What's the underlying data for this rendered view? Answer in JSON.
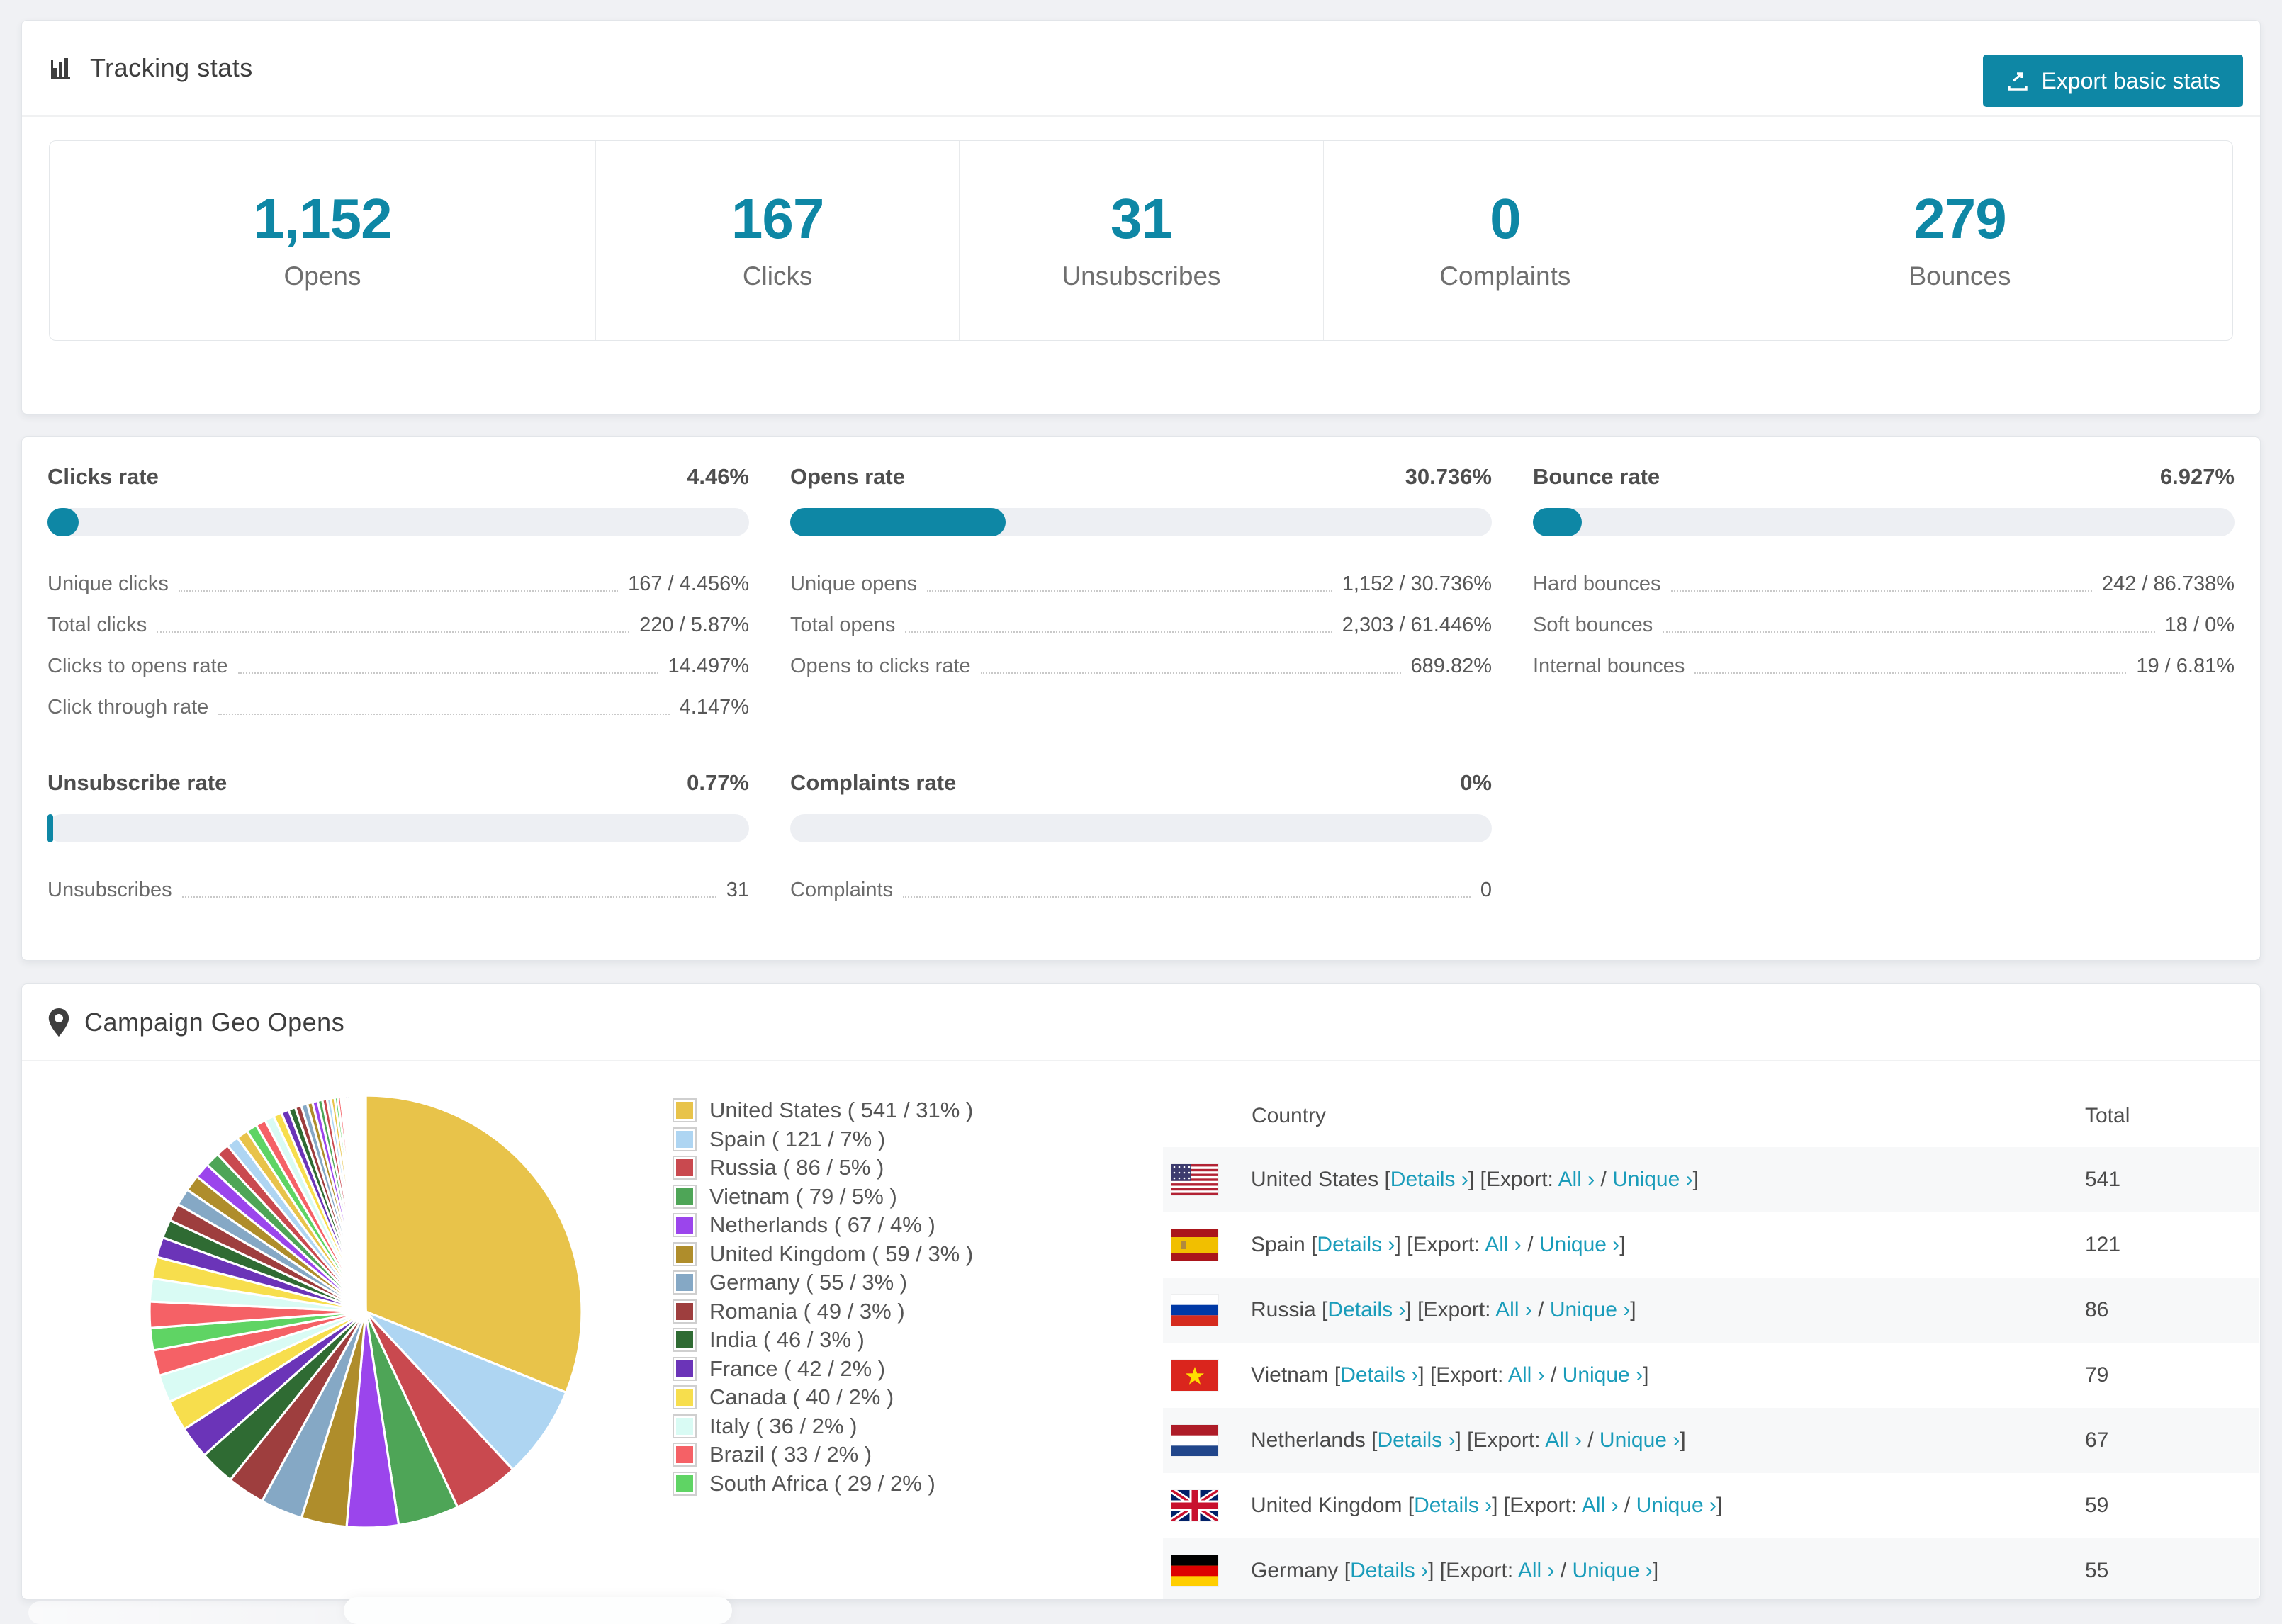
{
  "colors": {
    "accent": "#0e87a5",
    "link": "#1a9cba",
    "track": "#edeff3",
    "stripe": "#f7f8f9"
  },
  "tracking": {
    "title": "Tracking stats",
    "export_button": "Export basic stats",
    "stats": [
      {
        "value": "1,152",
        "label": "Opens"
      },
      {
        "value": "167",
        "label": "Clicks"
      },
      {
        "value": "31",
        "label": "Unsubscribes"
      },
      {
        "value": "0",
        "label": "Complaints"
      },
      {
        "value": "279",
        "label": "Bounces"
      }
    ]
  },
  "rates": [
    {
      "title": "Clicks rate",
      "value": "4.46%",
      "percent": 4.46,
      "rows": [
        {
          "label": "Unique clicks",
          "value": "167 / 4.456%"
        },
        {
          "label": "Total clicks",
          "value": "220 / 5.87%"
        },
        {
          "label": "Clicks to opens rate",
          "value": "14.497%"
        },
        {
          "label": "Click through rate",
          "value": "4.147%"
        }
      ]
    },
    {
      "title": "Opens rate",
      "value": "30.736%",
      "percent": 30.736,
      "rows": [
        {
          "label": "Unique opens",
          "value": "1,152 / 30.736%"
        },
        {
          "label": "Total opens",
          "value": "2,303 / 61.446%"
        },
        {
          "label": "Opens to clicks rate",
          "value": "689.82%"
        }
      ]
    },
    {
      "title": "Bounce rate",
      "value": "6.927%",
      "percent": 6.927,
      "rows": [
        {
          "label": "Hard bounces",
          "value": "242 / 86.738%"
        },
        {
          "label": "Soft bounces",
          "value": "18 / 0%"
        },
        {
          "label": "Internal bounces",
          "value": "19 / 6.81%"
        }
      ]
    },
    {
      "title": "Unsubscribe rate",
      "value": "0.77%",
      "percent": 0.77,
      "rows": [
        {
          "label": "Unsubscribes",
          "value": "31"
        }
      ]
    },
    {
      "title": "Complaints rate",
      "value": "0%",
      "percent": 0,
      "rows": [
        {
          "label": "Complaints",
          "value": "0"
        }
      ]
    }
  ],
  "geo": {
    "title": "Campaign Geo Opens",
    "table": {
      "col_country": "Country",
      "col_total": "Total",
      "details_label": "Details ›",
      "export_prefix": "Export:",
      "all_label": "All ›",
      "separator": "/",
      "unique_label": "Unique ›",
      "rows": [
        {
          "flag": "us",
          "country": "United States",
          "total": "541"
        },
        {
          "flag": "es",
          "country": "Spain",
          "total": "121"
        },
        {
          "flag": "ru",
          "country": "Russia",
          "total": "86"
        },
        {
          "flag": "vn",
          "country": "Vietnam",
          "total": "79"
        },
        {
          "flag": "nl",
          "country": "Netherlands",
          "total": "67"
        },
        {
          "flag": "gb",
          "country": "United Kingdom",
          "total": "59"
        },
        {
          "flag": "de",
          "country": "Germany",
          "total": "55"
        }
      ]
    },
    "chart_data": {
      "type": "pie",
      "title": "Campaign Geo Opens",
      "legend_position": "right",
      "start_angle_deg": -90,
      "direction": "clockwise",
      "categories": [
        "United States",
        "Spain",
        "Russia",
        "Vietnam",
        "Netherlands",
        "United Kingdom",
        "Germany",
        "Romania",
        "India",
        "France",
        "Canada",
        "Italy",
        "Brazil",
        "South Africa"
      ],
      "values": [
        541,
        121,
        86,
        79,
        67,
        59,
        55,
        49,
        46,
        42,
        40,
        36,
        33,
        29
      ],
      "percents": [
        31,
        7,
        5,
        5,
        4,
        3,
        3,
        3,
        3,
        2,
        2,
        2,
        2,
        2
      ],
      "legend_labels": [
        "United States ( 541 / 31% )",
        "Spain ( 121 / 7% )",
        "Russia ( 86 / 5% )",
        "Vietnam ( 79 / 5% )",
        "Netherlands ( 67 / 4% )",
        "United Kingdom ( 59 / 3% )",
        "Germany ( 55 / 3% )",
        "Romania ( 49 / 3% )",
        "India ( 46 / 3% )",
        "France ( 42 / 2% )",
        "Canada ( 40 / 2% )",
        "Italy ( 36 / 2% )",
        "Brazil ( 33 / 2% )",
        "South Africa ( 29 / 2% )"
      ],
      "colors": [
        "#E8C34A",
        "#AED5F2",
        "#C9494F",
        "#4EA557",
        "#9B45EC",
        "#AF8D2B",
        "#85A8C5",
        "#9E3E3E",
        "#2F6B33",
        "#6B34B8",
        "#F7DE4D",
        "#D9FBF4",
        "#F56166",
        "#5FD464"
      ],
      "others_unlabeled_slices_estimated": {
        "values": [
          34,
          30,
          28,
          26,
          24,
          23,
          22,
          21,
          20,
          19,
          17,
          16,
          15,
          14,
          13,
          12,
          11,
          10,
          9,
          8,
          8,
          7,
          7,
          6,
          6,
          5,
          5,
          4,
          4,
          3,
          3,
          3,
          3,
          2,
          2,
          2,
          2,
          2,
          1,
          1,
          1,
          1,
          1,
          1,
          1,
          1,
          1,
          1
        ]
      }
    }
  }
}
